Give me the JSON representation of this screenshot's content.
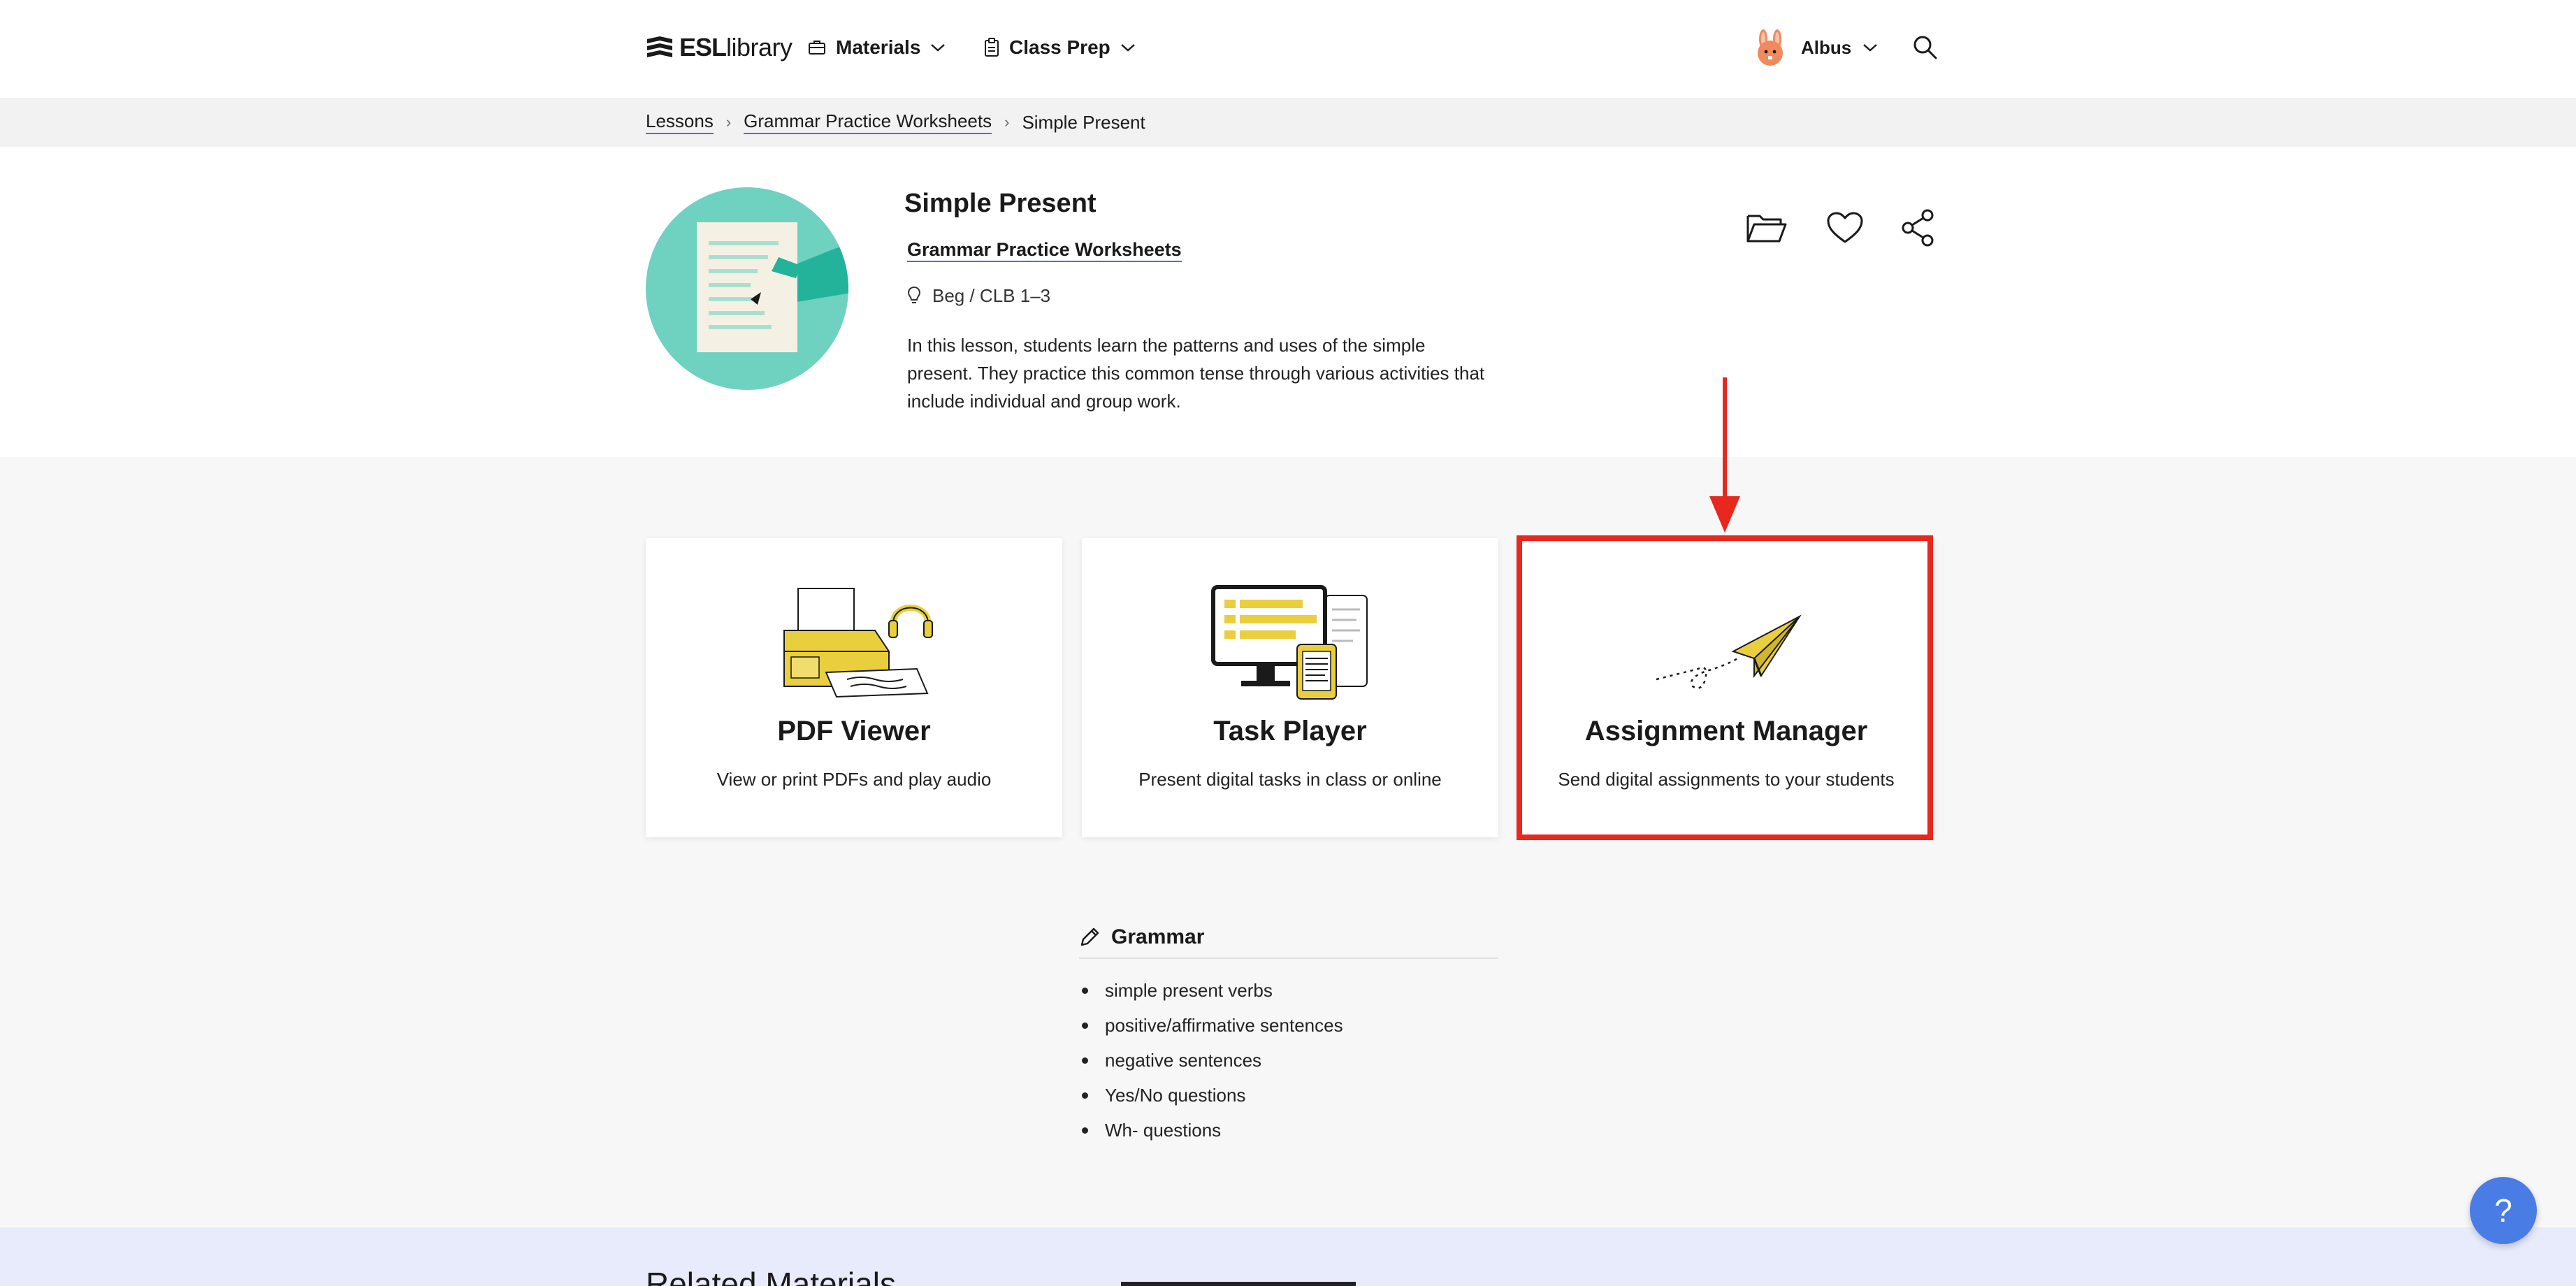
{
  "header": {
    "logo_bold": "ESL",
    "logo_light": "library",
    "nav": {
      "materials": "Materials",
      "class_prep": "Class Prep"
    },
    "user_name": "Albus"
  },
  "breadcrumb": {
    "items": [
      "Lessons",
      "Grammar Practice Worksheets",
      "Simple Present"
    ],
    "separator": "›"
  },
  "lesson": {
    "title": "Simple Present",
    "series": "Grammar Practice Worksheets",
    "level": "Beg / CLB 1–3",
    "description": "In this lesson, students learn the patterns and uses of the simple present. They practice this common tense through various activities that include individual and group work."
  },
  "cards": [
    {
      "title": "PDF Viewer",
      "subtitle": "View or print PDFs and play audio"
    },
    {
      "title": "Task Player",
      "subtitle": "Present digital tasks in class or online"
    },
    {
      "title": "Assignment Manager",
      "subtitle": "Send digital assignments to your students"
    }
  ],
  "grammar": {
    "heading": "Grammar",
    "items": [
      "simple present verbs",
      "positive/affirmative sentences",
      "negative sentences",
      "Yes/No questions",
      "Wh- questions"
    ]
  },
  "related": {
    "title": "Related Materials"
  },
  "help_label": "?",
  "colors": {
    "accent_blue": "#4a6cf7",
    "highlight_red": "#e8271f",
    "illustration_yellow": "#e9cf3e",
    "teal": "#6fd1c0",
    "help_blue": "#4a7ce6"
  }
}
